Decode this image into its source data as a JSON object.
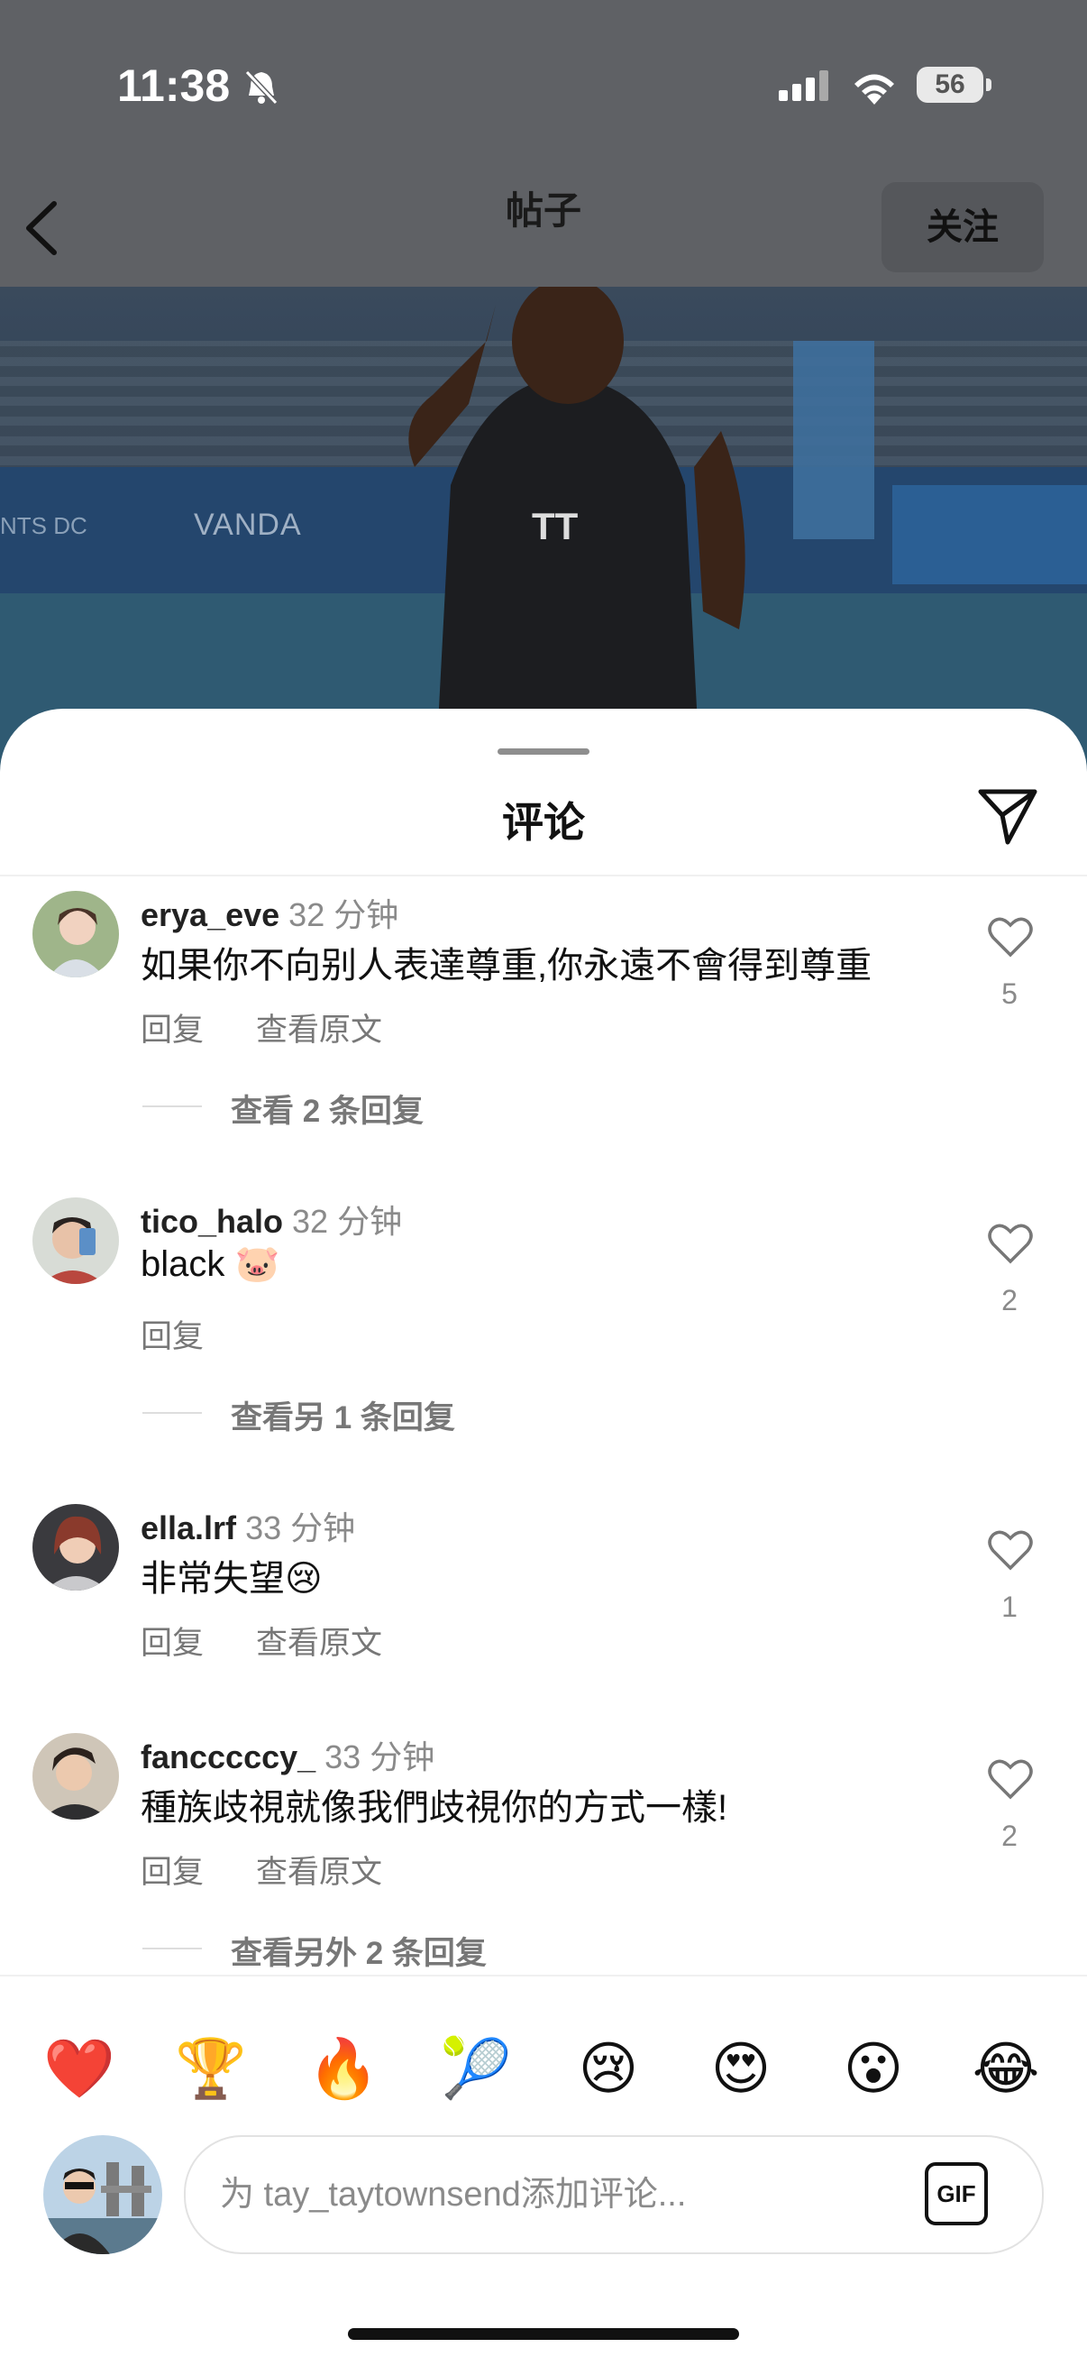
{
  "status": {
    "time": "11:38",
    "battery": "56"
  },
  "header": {
    "title": "帖子",
    "follow_label": "关注"
  },
  "photo": {
    "banner": "VANDA",
    "banner_left": "NTS DC"
  },
  "sheet": {
    "title": "评论"
  },
  "comments": [
    {
      "user": "erya_eve",
      "time": "32 分钟",
      "text": "如果你不向别人表達尊重,你永遠不會得到尊重",
      "reply": "回复",
      "translate": "查看原文",
      "likes": "5",
      "replies_link": "查看 2 条回复"
    },
    {
      "user": "tico_halo",
      "time": "32 分钟",
      "text": "black 🐷",
      "reply": "回复",
      "likes": "2",
      "replies_link": "查看另 1 条回复"
    },
    {
      "user": "ella.lrf",
      "time": "33 分钟",
      "text": "非常失望😢",
      "reply": "回复",
      "translate": "查看原文",
      "likes": "1"
    },
    {
      "user": "fancccccy_",
      "time": "33 分钟",
      "text": "種族歧視就像我們歧視你的方式一樣!",
      "reply": "回复",
      "translate": "查看原文",
      "likes": "2",
      "replies_link": "查看另外 2 条回复"
    }
  ],
  "quick_emojis": [
    "❤️",
    "🏆",
    "🔥",
    "🎾",
    "😢",
    "😍",
    "😮",
    "😂"
  ],
  "composer": {
    "placeholder": "为 tay_taytownsend添加评论...",
    "gif_label": "GIF"
  },
  "colors": {
    "accent_text": "#111111",
    "muted": "#8a8a8a",
    "overlay": "#5c5e62"
  }
}
